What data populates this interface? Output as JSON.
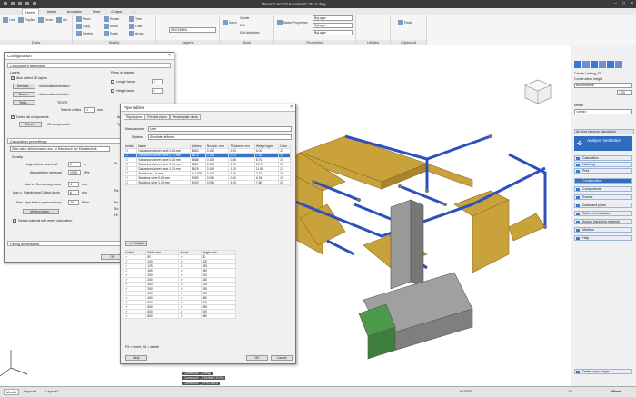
{
  "app": {
    "title": "liNear CAD 23   Kanalnetz 3D-3.dwg"
  },
  "ribbon_tabs": [
    "Home",
    "Insert",
    "Annotate",
    "View",
    "Output",
    "..."
  ],
  "ribbon": {
    "draw": {
      "label": "Draw",
      "buttons": [
        "Line",
        "Polyline",
        "Circle",
        "Arc"
      ]
    },
    "modify": {
      "label": "Modify",
      "buttons": [
        "Move",
        "Copy",
        "Stretch",
        "Rotate",
        "Mirror",
        "Scale",
        "Trim",
        "Fillet",
        "Array"
      ]
    },
    "layers": {
      "label": "Layers",
      "current": "ZEICHNEN"
    },
    "block": {
      "label": "Block",
      "buttons": [
        "Insert",
        "Create",
        "Edit",
        "Edit Attributes"
      ]
    },
    "properties": {
      "label": "Properties",
      "buttons": [
        "Match Properties"
      ],
      "values": [
        "ByLayer",
        "ByLayer",
        "ByLayer"
      ]
    },
    "utilities": {
      "label": "Utilities"
    },
    "clipboard": {
      "label": "Clipboard",
      "buttons": [
        "Paste"
      ]
    }
  },
  "config": {
    "title": "Configuration",
    "component_detection": "Component detection",
    "layers_label": "Layers",
    "also_detect": "Also detect 3D layers",
    "devices_btn": "Devices...",
    "devices_val": "<Automatic selection>",
    "ducts_btn": "Ducts...",
    "ducts_val": "<Automatic selection>",
    "texts_btn": "Texts...",
    "texts_val": "TEXTE",
    "search_radius_label": "Search radius",
    "search_radius": "1",
    "search_radius_unit": "mm",
    "detect_all": "Detect all components",
    "select_btn": "Select >",
    "components_count": "95 components",
    "pipes_in_drawing": "Pipes in drawing",
    "length_factor": "Length factor",
    "length_factor_val": "1",
    "height_factor": "Height factor",
    "height_factor_val": "1",
    "calc_presettings": "Calculation presettings",
    "zeta_value": "Zeta value determination acc. to Handbuch der Klimatechnik",
    "density": "Density",
    "height_above_sea": "Height above sea level",
    "height_val": "0",
    "height_unit": "m",
    "atm_pressure": "Atmospheric pressure",
    "atm_val": "1013",
    "atm_unit": "hPa",
    "max_v_connecting": "Max v., Connecting ducts",
    "max_v_connecting_val": "4",
    "unit_ms": "m/s",
    "max_v_distributing": "Max v., Distributing/Collect.ducts",
    "max_v_distributing_val": "6",
    "max_pipe_friction": "Max. pipe friction pressure loss",
    "max_pipe_friction_val": "20",
    "unit_pam": "Pa/m",
    "medium_table": "Medium table...",
    "detect_material": "Detect material with every calculation",
    "fitting_dimensions": "Fitting dimensions",
    "ok": "OK",
    "small_labels": [
      "Ar",
      "Ty",
      "St",
      "Re",
      "Ba",
      "So",
      "Hi"
    ]
  },
  "pipe_tables": {
    "title": "Pipe tables",
    "tabs": [
      "Rigid pipes",
      "Flexible pipes",
      "Rectangular ducts"
    ],
    "manufacturer_label": "Manufacturer",
    "manufacturer": "User",
    "system_label": "System",
    "system": "Simulate defined",
    "columns": [
      "Active",
      "Name",
      "Abbrev.",
      "Roughn. mm",
      "Thickness mm",
      "Weight kg/m²",
      "Color"
    ],
    "rows": [
      [
        "Galvanised sheet steel 0.63 mm",
        "B063",
        "0.150",
        "0.63",
        "6.00",
        "13"
      ],
      [
        "Galvanised sheet steel 0.75 mm",
        "B075",
        "0.150",
        "0.75",
        "7.54",
        "14"
      ],
      [
        "Galvanised sheet steel 0.88 mm",
        "B088",
        "0.150",
        "0.88",
        "8.70",
        "15"
      ],
      [
        "Galvanised sheet steel 1.13 mm",
        "B113",
        "0.150",
        "1.13",
        "10.76",
        "16"
      ],
      [
        "Galvanised sheet steel 1.25 mm",
        "B125",
        "0.150",
        "1.25",
        "11.56",
        "17"
      ],
      [
        "Aluminium 1.0 mm",
        "AL1000",
        "0.100",
        "1.00",
        "2.70",
        "18"
      ],
      [
        "Stainless steel 0.80 mm",
        "E080",
        "0.050",
        "0.80",
        "6.34",
        "19"
      ],
      [
        "Stainless steel 1.00 mm",
        "E100",
        "0.050",
        "1.00",
        "7.80",
        "20"
      ]
    ],
    "details_btn": "<< Details",
    "width_col": "Width mm",
    "height_col": "Height mm",
    "active_col": "Active",
    "widths": [
      "80",
      "100",
      "125",
      "150",
      "200",
      "250",
      "300",
      "350",
      "400",
      "450",
      "500",
      "550",
      "600",
      "650"
    ],
    "heights": [
      "80",
      "100",
      "125",
      "150",
      "200",
      "250",
      "300",
      "350",
      "400",
      "450",
      "500",
      "550",
      "600",
      "650"
    ],
    "hint": "F5 = insert,  F6 = delete",
    "help": "Help",
    "ok": "OK",
    "cancel": "Cancel"
  },
  "right_panel": {
    "create_label": "Create Leitung_3D",
    "construction_height": "Construction height",
    "height_combo": "Bodenebene",
    "height_val": "-100",
    "media_label": "Media",
    "media_val": "<ohne>",
    "section": "Air duct network calculation",
    "banner": "Analyse Ventilation",
    "items": [
      "Calculation",
      "Labeling",
      "Print",
      "Configuration",
      "Components",
      "Rooms",
      "Ducts and pipes",
      "Tables of insulation",
      "Assign insulating material",
      "Medium",
      "Help"
    ],
    "delete_report": "Delete report layer"
  },
  "status": {
    "tabs": [
      "Model",
      "Layout1",
      "Layout2"
    ],
    "model": "MODEL",
    "cmd1": "Command: _Fitting",
    "cmd2": "Command: _CONNECTION",
    "cmd3": "Command: _PIPELINES",
    "scale": "1:1",
    "brand": "liNear"
  },
  "colors": {
    "duct": "#c9a23c",
    "pipe": "#2f4fbf",
    "unit": "#888888",
    "green": "#4d9b4a",
    "accent": "#2f6bbf"
  }
}
